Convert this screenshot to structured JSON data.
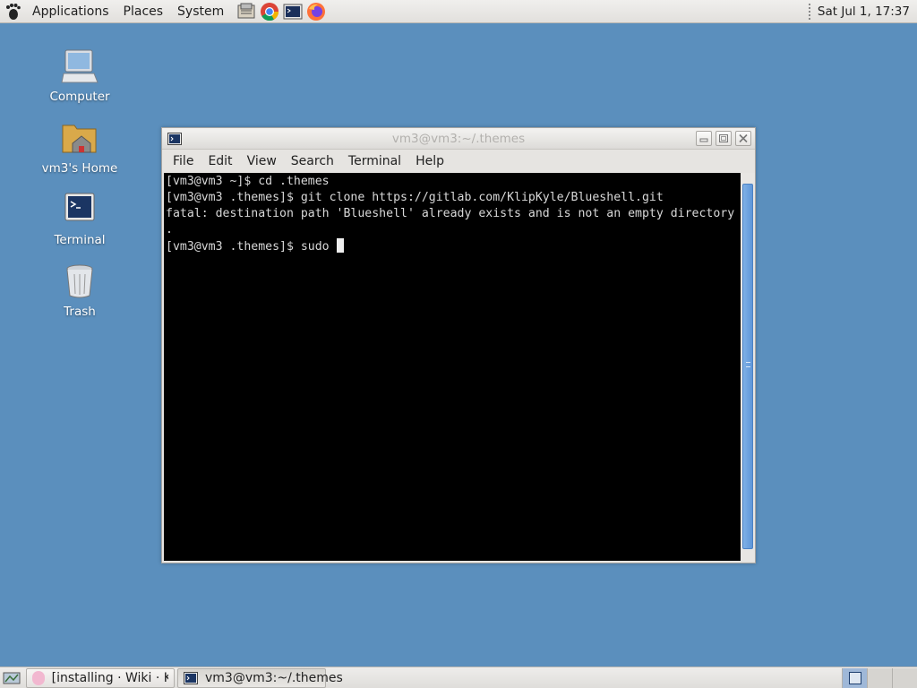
{
  "top_panel": {
    "menus": [
      "Applications",
      "Places",
      "System"
    ],
    "launchers": [
      "files-icon",
      "chrome-icon",
      "terminal-launcher-icon",
      "firefox-icon"
    ],
    "clock": "Sat Jul  1, 17:37"
  },
  "desktop": {
    "icons": [
      {
        "label": "Computer",
        "icon": "computer-icon"
      },
      {
        "label": "vm3's Home",
        "icon": "home-folder-icon"
      },
      {
        "label": "Terminal",
        "icon": "terminal-icon"
      },
      {
        "label": "Trash",
        "icon": "trash-icon"
      }
    ]
  },
  "terminal_window": {
    "title": "vm3@vm3:~/.themes",
    "menus": [
      "File",
      "Edit",
      "View",
      "Search",
      "Terminal",
      "Help"
    ],
    "lines": [
      "[vm3@vm3 ~]$ cd .themes",
      "[vm3@vm3 .themes]$ git clone https://gitlab.com/KlipKyle/Blueshell.git",
      "fatal: destination path 'Blueshell' already exists and is not an empty directory",
      ".",
      "[vm3@vm3 .themes]$ sudo "
    ]
  },
  "bottom_panel": {
    "tasks": [
      {
        "label": "[installing · Wiki · Ky..."
      },
      {
        "label": "vm3@vm3:~/.themes"
      }
    ]
  },
  "colors": {
    "desktop": "#5b8fbd",
    "terminal_bg": "#000000",
    "terminal_fg": "#d8d8d8",
    "scroll_thumb": "#6ba2de"
  }
}
